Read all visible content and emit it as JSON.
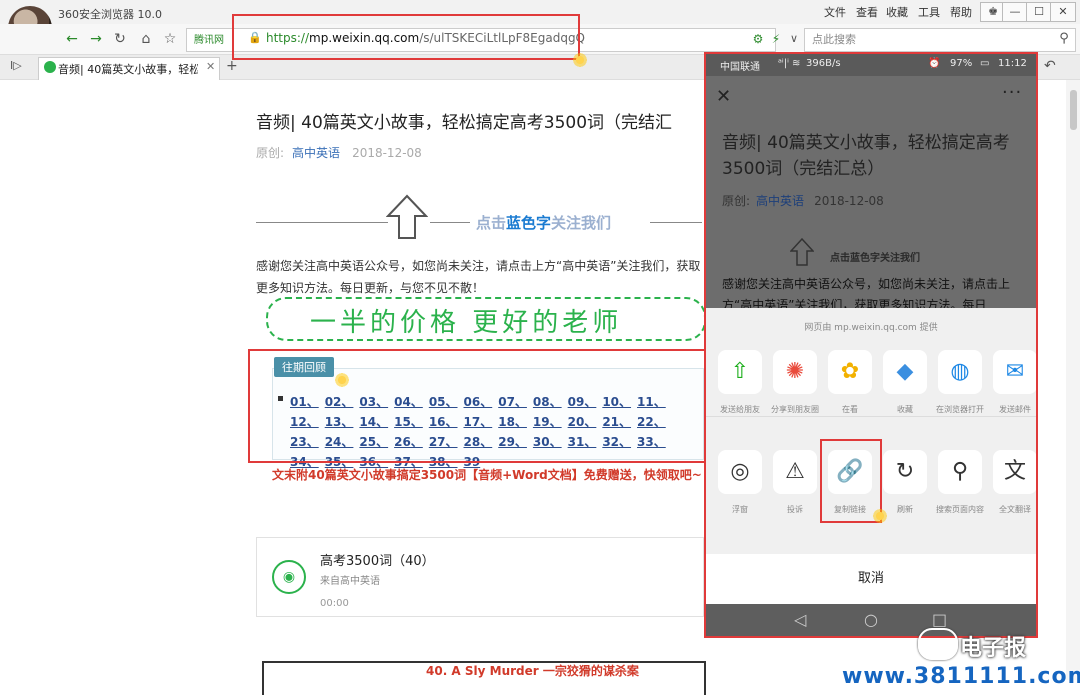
{
  "browser": {
    "title": "360安全浏览器 10.0",
    "menu": [
      "文件",
      "查看",
      "收藏",
      "工具",
      "帮助"
    ],
    "url_badge": "腾讯网",
    "url_scheme": "https://",
    "url_host": "mp.weixin.qq.com",
    "url_path": "/s/ulTSKECiLtlLpF8EgadqgQ",
    "search_placeholder": "点此搜索",
    "tab_label": "音频| 40篇英文小故事，轻松搞定",
    "new_tab": "+"
  },
  "article": {
    "title": "音频| 40篇英文小故事，轻松搞定高考3500词（完结汇",
    "meta_label": "原创:",
    "source": "高中英语",
    "date": "2018-12-08",
    "follow_pre": "点击",
    "follow_blue": "蓝色字",
    "follow_post": "关注我们",
    "para": "感谢您关注高中英语公众号，如您尚未关注，请点击上方“高中英语”关注我们，获取更多知识方法。每日更新，与您不见不散！",
    "slogan": "一半的价格 更好的老师",
    "review_tag": "往期回顾",
    "episodes": [
      "01",
      "02",
      "03",
      "04",
      "05",
      "06",
      "07",
      "08",
      "09",
      "10",
      "11",
      "12",
      "13",
      "14",
      "15",
      "16",
      "17",
      "18",
      "19",
      "20",
      "21",
      "22",
      "23",
      "24",
      "25",
      "26",
      "27",
      "28",
      "29",
      "30",
      "31",
      "32",
      "33",
      "34",
      "35",
      "36",
      "37",
      "38",
      "39"
    ],
    "gift": "文末附40篇英文小故事搞定3500词【音频+Word文档】免费赠送，快领取吧~",
    "audio_title": "高考3500词（40）",
    "audio_from": "来自高中英语",
    "audio_time": "00:00",
    "story_title": "40. A Sly Murder 一宗狡猾的谋杀案"
  },
  "phone": {
    "carrier": "中国联通",
    "speed": "396B/s",
    "battery": "97%",
    "time": "11:12",
    "title": "音频| 40篇英文小故事，轻松搞定高考3500词（完结汇总）",
    "meta_label": "原创:",
    "source": "高中英语",
    "date": "2018-12-08",
    "follow": "点击蓝色字关注我们",
    "para": "感谢您关注高中英语公众号，如您尚未关注，请点击上方“高中英语”关注我们，获取更多知识方法。每日",
    "sheet_source": "网页由 mp.weixin.qq.com 提供",
    "row1": [
      {
        "label": "发送给朋友",
        "icon": "share-friend-icon",
        "color": "#1aad19"
      },
      {
        "label": "分享到朋友圈",
        "icon": "moments-icon",
        "color": "#e94b3c"
      },
      {
        "label": "在看",
        "icon": "wow-icon",
        "color": "#f2b100"
      },
      {
        "label": "收藏",
        "icon": "favorite-icon",
        "color": "#3b8fe0"
      },
      {
        "label": "在浏览器打开",
        "icon": "browser-icon",
        "color": "#1e88e5"
      },
      {
        "label": "发送邮件",
        "icon": "mail-icon",
        "color": "#1e88e5"
      }
    ],
    "row2": [
      {
        "label": "浮窗",
        "icon": "float-window-icon"
      },
      {
        "label": "投诉",
        "icon": "complaint-icon"
      },
      {
        "label": "复制链接",
        "icon": "copy-link-icon"
      },
      {
        "label": "刷新",
        "icon": "refresh-icon"
      },
      {
        "label": "搜索页面内容",
        "icon": "search-page-icon"
      },
      {
        "label": "全文翻译",
        "icon": "translate-icon"
      }
    ],
    "cancel": "取消"
  },
  "watermark": {
    "title": "电子报",
    "url": "www.3811111.com"
  }
}
